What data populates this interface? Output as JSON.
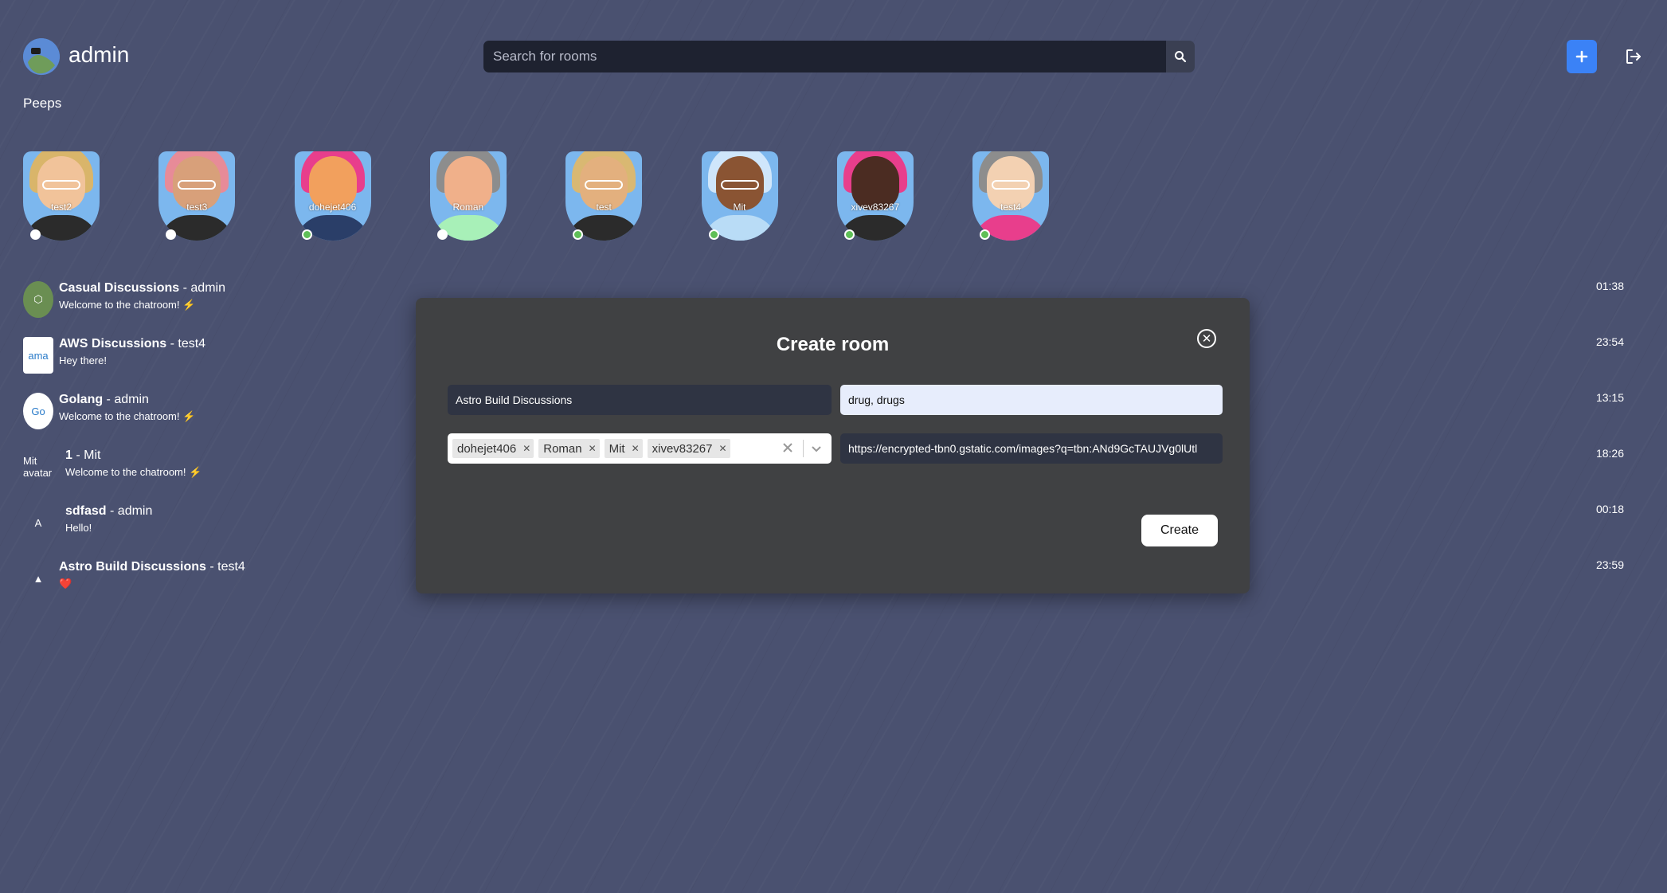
{
  "header": {
    "username": "admin",
    "search_placeholder": "Search for rooms",
    "icons": {
      "search": "search-icon",
      "add": "plus-icon",
      "logout": "logout-icon"
    }
  },
  "peeps": {
    "title": "Peeps",
    "items": [
      {
        "name": "test2",
        "online": false,
        "hair": "#d9b56a",
        "skin": "#f1c39a",
        "shirt": "#2b2b2b",
        "glasses": true
      },
      {
        "name": "test3",
        "online": false,
        "hair": "#e78b98",
        "skin": "#d8a07a",
        "shirt": "#2b2b2b",
        "glasses": true
      },
      {
        "name": "dohejet406",
        "online": true,
        "hair": "#e83e8c",
        "skin": "#f2a05d",
        "shirt": "#2a3e68",
        "glasses": false
      },
      {
        "name": "Roman",
        "online": false,
        "hair": "#8d8d8d",
        "skin": "#f0b08a",
        "shirt": "#a8f0b8",
        "glasses": false
      },
      {
        "name": "test",
        "online": true,
        "hair": "#d9b872",
        "skin": "#e3b07e",
        "shirt": "#2b2b2b",
        "glasses": true
      },
      {
        "name": "Mit",
        "online": true,
        "hair": "#cfe6fb",
        "skin": "#8a5433",
        "shirt": "#b9dcf6",
        "glasses": true
      },
      {
        "name": "xivev83267",
        "online": true,
        "hair": "#e83e8c",
        "skin": "#4b2c22",
        "shirt": "#2b2b2b",
        "glasses": false
      },
      {
        "name": "test4",
        "online": true,
        "hair": "#8d8d8d",
        "skin": "#f3d1b2",
        "shirt": "#e83e8c",
        "glasses": true
      }
    ]
  },
  "rooms": [
    {
      "title": "Casual Discussions",
      "owner": " - admin",
      "message": "Welcome to the chatroom! ⚡",
      "time": "01:38",
      "icon_label": "⬡",
      "icon_bg": "#6a8e52"
    },
    {
      "title": "AWS Discussions",
      "owner": " - test4",
      "message": "Hey there!",
      "time": "23:54",
      "icon_label": "ama",
      "icon_bg": "#ffffff"
    },
    {
      "title": "Golang",
      "owner": " - admin",
      "message": "Welcome to the chatroom! ⚡",
      "time": "13:15",
      "icon_label": "Go",
      "icon_bg": "#ffffff"
    },
    {
      "title": "1",
      "owner": " - Mit",
      "message": "Welcome to the chatroom! ⚡",
      "time": "18:26",
      "icon_label": "Mit avatar",
      "icon_bg": "transparent"
    },
    {
      "title": "sdfasd",
      "owner": " - admin",
      "message": "Hello!",
      "time": "00:18",
      "icon_label": "A",
      "icon_bg": "transparent"
    },
    {
      "title": "Astro Build Discussions",
      "owner": " - test4",
      "message": "❤️",
      "time": "23:59",
      "icon_label": "▲",
      "icon_bg": "transparent"
    }
  ],
  "modal": {
    "title": "Create room",
    "name_value": "Astro Build Discussions",
    "tags_value": "drug, drugs",
    "image_url_value": "https://encrypted-tbn0.gstatic.com/images?q=tbn:ANd9GcTAUJVg0lUtl",
    "members": [
      "dohejet406",
      "Roman",
      "Mit",
      "xivev83267"
    ],
    "create_label": "Create",
    "close_symbol": "✕"
  },
  "colors": {
    "background": "#4a5170",
    "accent": "#3b82f6",
    "online": "#5fbf57",
    "offline": "#ffffff",
    "modal_bg": "#404143"
  }
}
